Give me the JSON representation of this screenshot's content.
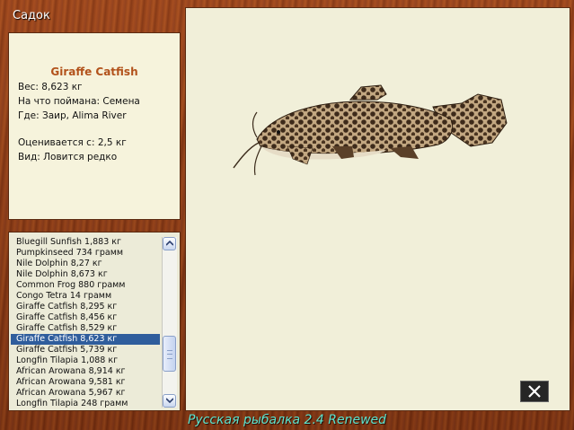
{
  "window": {
    "title": "Садок"
  },
  "info": {
    "name": "Giraffe Catfish",
    "weight": "Вес: 8,623 кг",
    "bait": "На что поймана: Семена",
    "location": "Где: Заир, Alima River",
    "value": "Оценивается с: 2,5 кг",
    "rarity": "Вид: Ловится редко"
  },
  "catch_list": [
    "Bluegill Sunfish 1,883 кг",
    "Pumpkinseed 734 грамм",
    "Nile Dolphin 8,27 кг",
    "Nile Dolphin 8,673 кг",
    "Common Frog 880 грамм",
    "Congo Tetra 14 грамм",
    "Giraffe Catfish 8,295 кг",
    "Giraffe Catfish 8,456 кг",
    "Giraffe Catfish 8,529 кг",
    "Giraffe Catfish 8,623 кг",
    "Giraffe Catfish 5,739 кг",
    "Longfin Tilapia 1,088 кг",
    "African Arowana 8,914 кг",
    "African Arowana 9,581 кг",
    "African Arowana 5,967 кг",
    "Longfin Tilapia 248 грамм"
  ],
  "selected_index": 9,
  "footer": "Русская рыбалка 2.4 Renewed",
  "icons": {
    "close": "close-icon",
    "scroll_up": "arrow-up-icon",
    "scroll_down": "arrow-down-icon"
  },
  "colors": {
    "accent": "#b2521b",
    "selection": "#2f5d9c",
    "footer": "#5de3ce"
  }
}
